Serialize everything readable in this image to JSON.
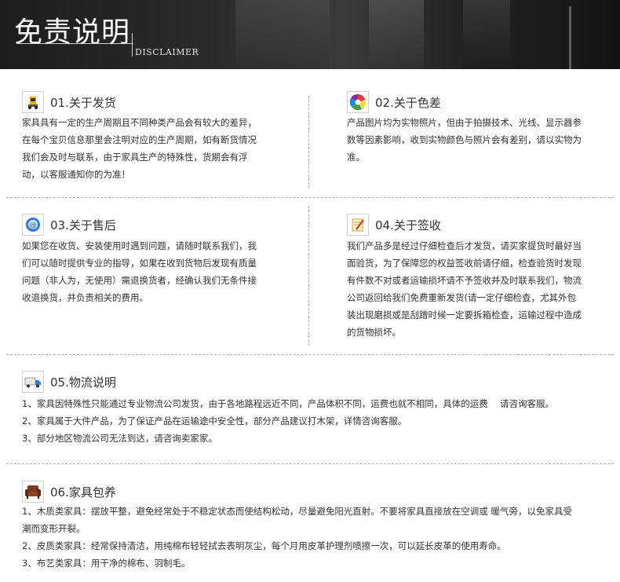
{
  "banner": {
    "title": "免责说明",
    "subtitle": "DISCLAIMER"
  },
  "s1": {
    "title": "01.关于发货",
    "icon": "forklift-icon",
    "lines": [
      "家具具有一定的生产周期且不同种类产品会有较大的差异，",
      "在每个宝贝信息那里会注明对应的生产周期，如有断货情况",
      "我们会及时与联系，由于家具生产的特殊性，货期会有浮",
      "动，以客服通知你的为准！"
    ]
  },
  "s2": {
    "title": "02.关于色差",
    "icon": "color-wheel-icon",
    "lines": [
      "产品图片均为实物照片，但由于拍摄技术、光线、显示器参",
      "数等因素影响，收到实物颜色与照片会有差别，请以实物为",
      "准。"
    ]
  },
  "s3": {
    "title": "03.关于售后",
    "icon": "support-icon",
    "lines": [
      "如果您在收货、安装使用时遇到问题，请随时联系我们，我",
      "们可以随时提供专业的指导，如果在收到货物后发现有质量",
      "问题（非人为，无使用）需退换货者，经确认我们无条件接",
      "收退换货，并负责相关的费用。"
    ]
  },
  "s4": {
    "title": "04.关于签收",
    "icon": "sign-note-icon",
    "lines": [
      "我们产品多是经过仔细检查后才发货，请买家提货时最好当",
      "面验货，为了保障您的权益签收前请仔细，检查验货时发现",
      "有件数不对或者运输损坏请不予签收并及时联系我们，物流",
      "公司返回给我们免费重新发货(请一定仔细检查，尤其外包",
      "装出现磨损或是刮蹭时候一定要拆箱检查，运输过程中造成",
      "的货物损坏。"
    ]
  },
  "s5": {
    "title": "05.物流说明",
    "icon": "truck-icon",
    "lines": [
      "1、家具因特殊性只能通过专业物流公司发货，由于各地路程远近不同，产品体积不同，运费也就不相同，具体的运费　  请咨询客服。",
      "2、家具属于大件产品，为了保证产品在运输途中安全性，部分产品建议打木架，详情咨询客服。",
      "3、部分地区物流公司无法到达，请咨询卖家家。"
    ]
  },
  "s6": {
    "title": "06.家具包养",
    "icon": "armchair-icon",
    "lines": [
      "1、木质类家具：摆放平整，避免经常处于不稳定状态而使结构松动，尽量避免阳光直射。不要将家具直接放在空调或 暖气旁，以免家具受",
      "      潮而变形开裂。",
      "2、皮质类家具：经常保持清洁，用纯棉布轻轻拭去表明灰尘，每个月用皮革护理剂喷擦一次，可以延长皮革的使用寿命。",
      "3、布艺类家具：用干净的棉布、羽制毛。"
    ]
  }
}
